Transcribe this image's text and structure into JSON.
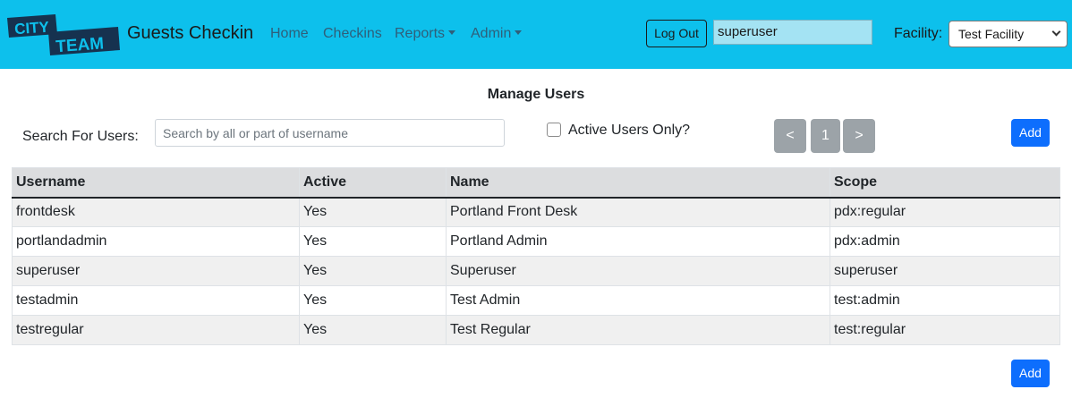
{
  "colors": {
    "navbar_bg": "#0dc0ec",
    "logo_dark": "#16324f",
    "add_button": "#0d6efd",
    "pager_button": "#9ca3a8",
    "user_field_bg": "#a4e3f3"
  },
  "navbar": {
    "logo_text_1": "CITY",
    "logo_text_2": "TEAM",
    "brand": "Guests Checkin",
    "links": {
      "home": "Home",
      "checkins": "Checkins",
      "reports": "Reports",
      "admin": "Admin"
    },
    "logout_label": "Log Out",
    "user_value": "superuser",
    "facility_label": "Facility:",
    "facility_selected": "Test Facility"
  },
  "main": {
    "title": "Manage Users",
    "search_label": "Search For Users:",
    "search_placeholder": "Search by all or part of username",
    "active_only_label": "Active Users Only?",
    "active_only_checked": false,
    "pager": {
      "prev": "<",
      "page": "1",
      "next": ">"
    },
    "add_label": "Add"
  },
  "table": {
    "headers": [
      "Username",
      "Active",
      "Name",
      "Scope"
    ],
    "rows": [
      [
        "frontdesk",
        "Yes",
        "Portland Front Desk",
        "pdx:regular"
      ],
      [
        "portlandadmin",
        "Yes",
        "Portland Admin",
        "pdx:admin"
      ],
      [
        "superuser",
        "Yes",
        "Superuser",
        "superuser"
      ],
      [
        "testadmin",
        "Yes",
        "Test Admin",
        "test:admin"
      ],
      [
        "testregular",
        "Yes",
        "Test Regular",
        "test:regular"
      ]
    ]
  }
}
